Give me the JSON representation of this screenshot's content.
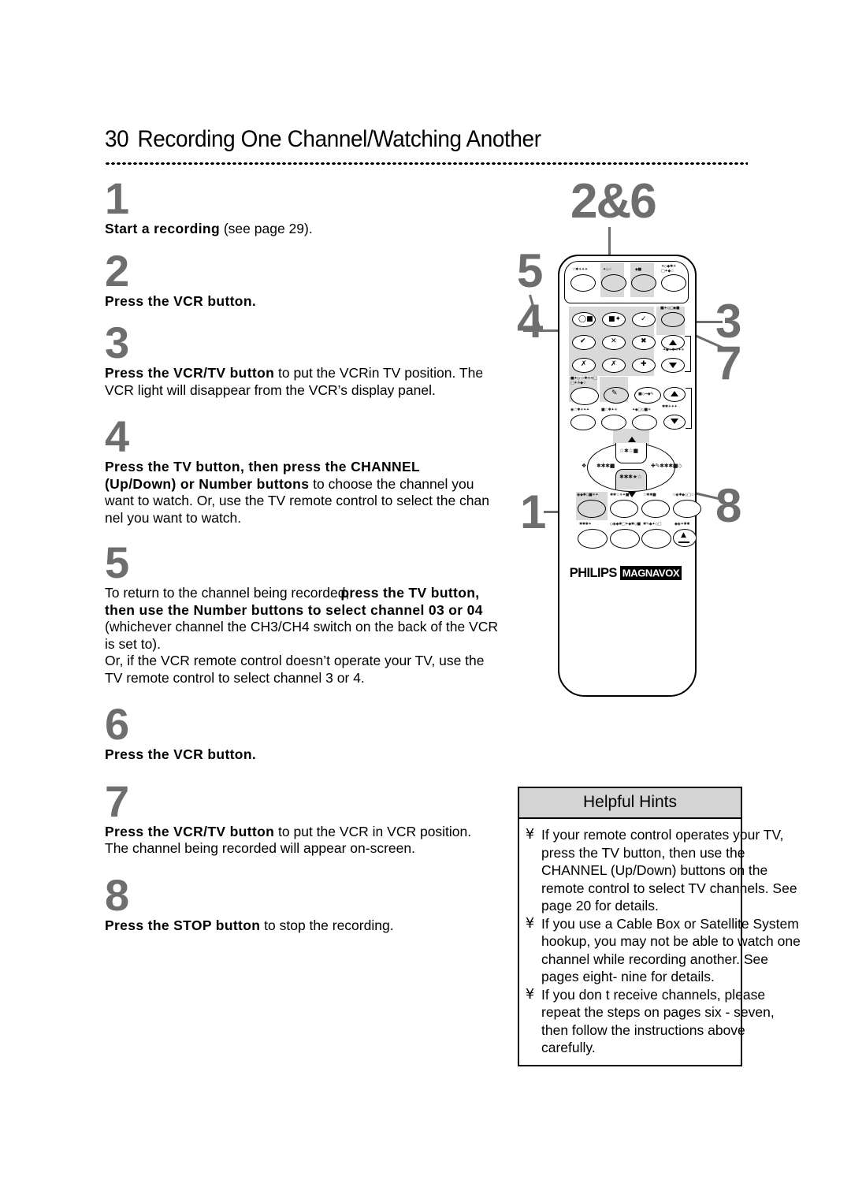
{
  "page": {
    "number": "30",
    "title": "Recording One Channel/Watching Another"
  },
  "steps": [
    {
      "num": "1",
      "lines": [
        [
          {
            "t": "Start a recording",
            "b": true
          },
          {
            "t": " (see page 29).",
            "b": false
          }
        ]
      ]
    },
    {
      "num": "2",
      "lines": [
        [
          {
            "t": "Press the VCR button.",
            "b": true
          }
        ]
      ]
    },
    {
      "num": "3",
      "lines": [
        [
          {
            "t": "Press the VCR/TV button",
            "b": true
          },
          {
            "t": " to put the VCRin TV position. The",
            "b": false
          }
        ],
        [
          {
            "t": "VCR light will disappear from the VCR’s display panel.",
            "b": false
          }
        ]
      ]
    },
    {
      "num": "4",
      "lines": [
        [
          {
            "t": "Press the TV button, then press the CHANNEL",
            "b": true
          }
        ],
        [
          {
            "t": "(Up/Down) or Number buttons",
            "b": true
          },
          {
            "t": " to choose the channel you",
            "b": false
          }
        ],
        [
          {
            "t": "want to watch. Or, use the TV remote control to select the chan",
            "b": false
          }
        ],
        [
          {
            "t": "nel you want to watch.",
            "b": false
          }
        ]
      ]
    },
    {
      "num": "5",
      "lines": [
        [
          {
            "t": "To return to the channel being recorded,",
            "b": false
          },
          {
            "t": "press the TV button,",
            "b": true,
            "overlap": true
          }
        ],
        [
          {
            "t": "then use the Number buttons to select channel 03 or 04",
            "b": true
          }
        ],
        [
          {
            "t": "(whichever channel the CH3/CH4 switch on the back of the VCR",
            "b": false
          }
        ],
        [
          {
            "t": "is set to).",
            "b": false
          }
        ],
        [
          {
            "t": "Or, if the VCR remote control doesn’t operate your TV, use the",
            "b": false
          }
        ],
        [
          {
            "t": "TV remote control to select channel 3 or 4.",
            "b": false
          }
        ]
      ]
    },
    {
      "num": "6",
      "lines": [
        [
          {
            "t": "Press the VCR button.",
            "b": true
          }
        ]
      ]
    },
    {
      "num": "7",
      "lines": [
        [
          {
            "t": "Press the VCR/TV button",
            "b": true
          },
          {
            "t": " to put the VCR in VCR position.",
            "b": false
          }
        ],
        [
          {
            "t": "The channel being recorded will appear on-screen.",
            "b": false
          }
        ]
      ]
    },
    {
      "num": "8",
      "lines": [
        [
          {
            "t": "Press the STOP button",
            "b": true
          },
          {
            "t": " to stop the recording.",
            "b": false
          }
        ]
      ]
    }
  ],
  "callouts": [
    {
      "label": "2&6"
    },
    {
      "label": "5"
    },
    {
      "label": "4"
    },
    {
      "label": "3"
    },
    {
      "label": "7"
    },
    {
      "label": "1"
    },
    {
      "label": "8"
    }
  ],
  "remote": {
    "brand": "PHILIPS",
    "sub_brand": "MAGNAVOX"
  },
  "hints": {
    "header": "Helpful Hints",
    "bullet": "¥",
    "items": [
      "If your remote control operates your TV, press the TV button, then use the CHANNEL (Up/Down) buttons on the remote control to select TV channels. See page 20 for details.",
      "If you use a Cable Box or Satellite System hookup, you may not be able to watch one channel while recording another. See pages eight- nine for details.",
      "If you don t receive channels, please repeat the steps on pages six - seven, then follow the instructions above carefully."
    ]
  },
  "colors": {
    "step_number": "#6e6e6e",
    "hints_header_bg": "#d4d4d4",
    "button_highlight": "#d9d9d9",
    "text": "#000000"
  }
}
